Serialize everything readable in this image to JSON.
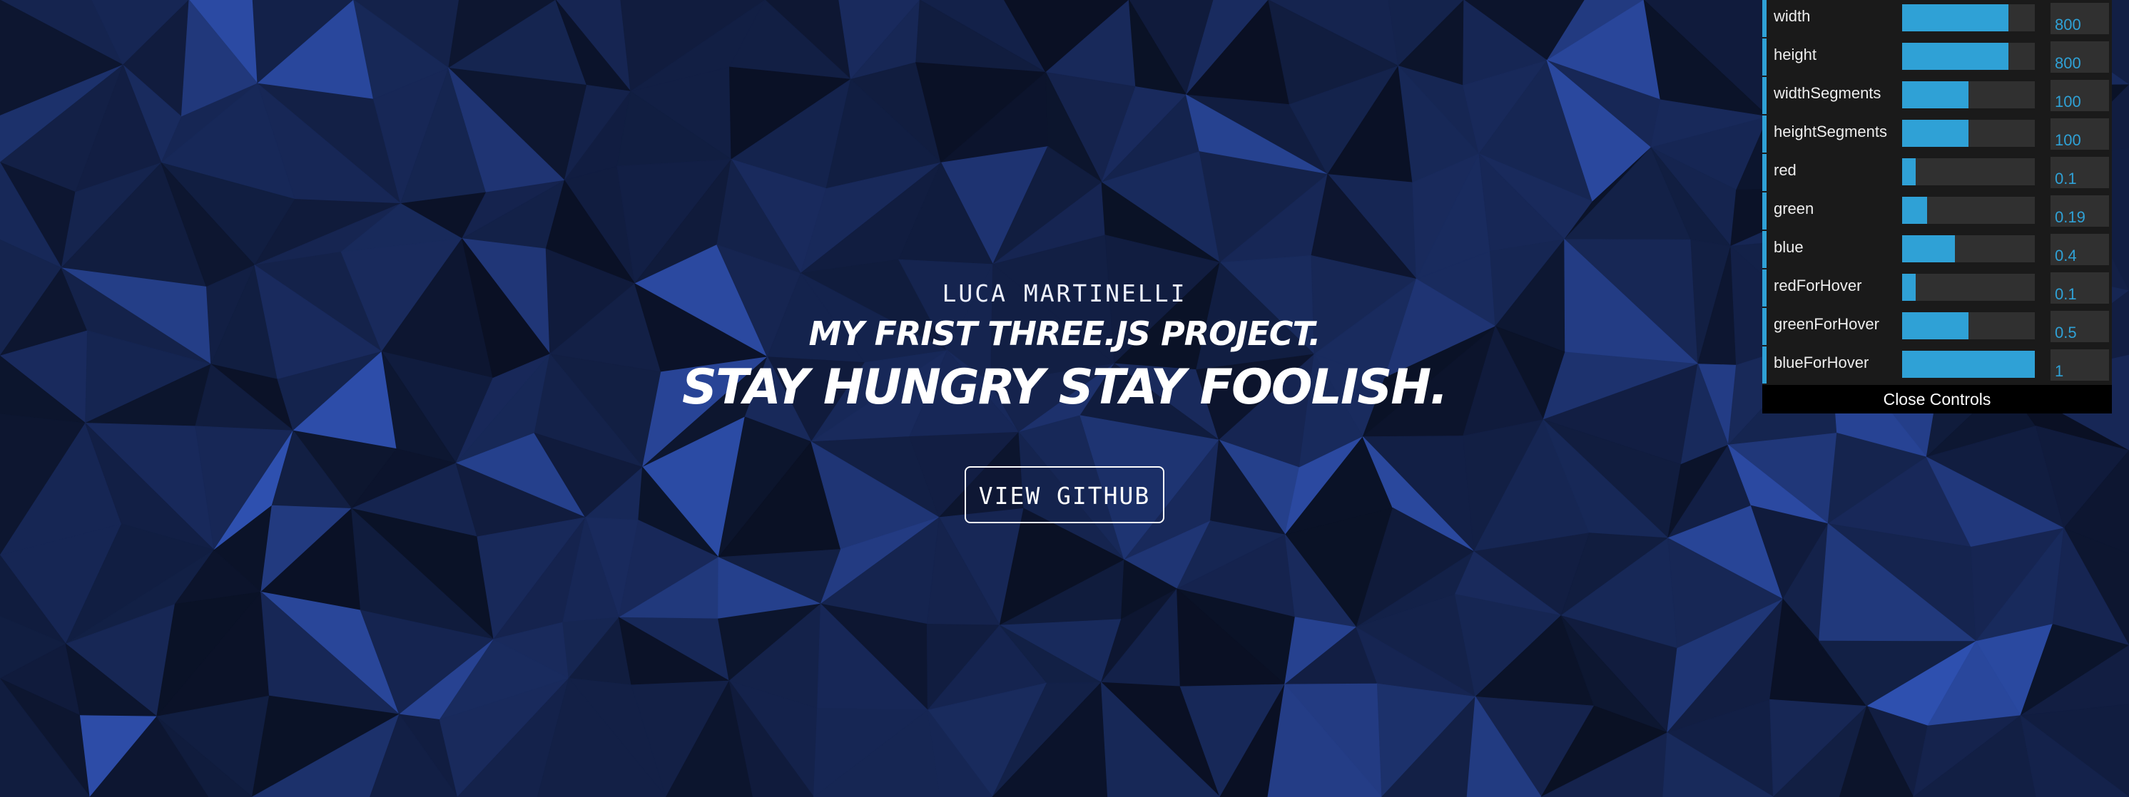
{
  "hero": {
    "author": "LUCA MARTINELLI",
    "subtitle": "MY FRIST THREE.JS PROJECT.",
    "tagline": "STAY HUNGRY STAY FOOLISH.",
    "button_label": "VIEW GITHUB"
  },
  "controls": {
    "rows": [
      {
        "label": "width",
        "value": "800",
        "fraction": 0.8
      },
      {
        "label": "height",
        "value": "800",
        "fraction": 0.8
      },
      {
        "label": "widthSegments",
        "value": "100",
        "fraction": 0.5
      },
      {
        "label": "heightSegments",
        "value": "100",
        "fraction": 0.5
      },
      {
        "label": "red",
        "value": "0.1",
        "fraction": 0.1
      },
      {
        "label": "green",
        "value": "0.19",
        "fraction": 0.19
      },
      {
        "label": "blue",
        "value": "0.4",
        "fraction": 0.4
      },
      {
        "label": "redForHover",
        "value": "0.1",
        "fraction": 0.1
      },
      {
        "label": "greenForHover",
        "value": "0.5",
        "fraction": 0.5
      },
      {
        "label": "blueForHover",
        "value": "1",
        "fraction": 1.0
      }
    ],
    "close_label": "Close Controls"
  },
  "colors": {
    "background": "#15244f",
    "accent": "#2fa1d6",
    "panel": "#1a1a1a"
  }
}
